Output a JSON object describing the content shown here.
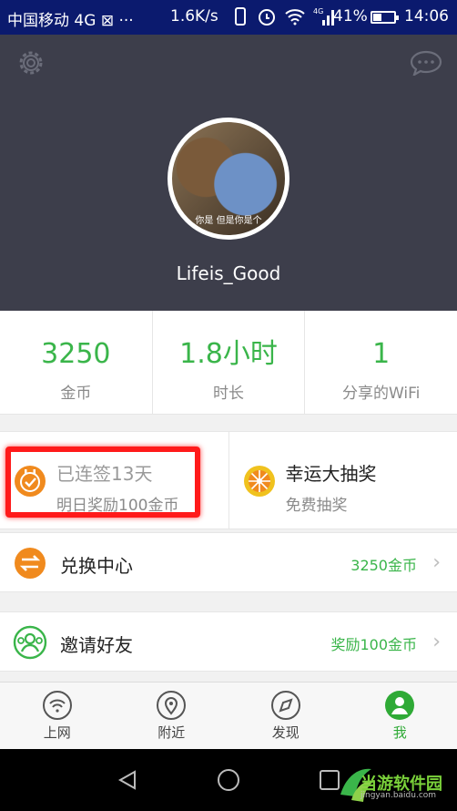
{
  "status_bar": {
    "carrier": "中国移动 4G",
    "extra": "⊠ ···",
    "speed": "1.6K/s",
    "network_type": "4G",
    "battery_percent_text": "41%",
    "battery_level": 0.41,
    "time": "14:06"
  },
  "profile": {
    "avatar_caption": "你是 但是你是个",
    "username": "Lifeis_Good"
  },
  "stats": [
    {
      "value": "3250",
      "label": "金币"
    },
    {
      "value": "1.8小时",
      "label": "时长"
    },
    {
      "value": "1",
      "label": "分享的WiFi"
    }
  ],
  "cards": {
    "signin": {
      "title": "已连签13天",
      "subtitle": "明日奖励100金币"
    },
    "lottery": {
      "title": "幸运大抽奖",
      "subtitle": "免费抽奖"
    }
  },
  "rows": {
    "exchange": {
      "label": "兑换中心",
      "right": "3250金币"
    },
    "invite": {
      "label": "邀请好友",
      "right": "奖励100金币"
    }
  },
  "bottom_nav": [
    {
      "label": "上网",
      "icon": "wifi-icon"
    },
    {
      "label": "附近",
      "icon": "location-pin-icon"
    },
    {
      "label": "发现",
      "icon": "compass-icon"
    },
    {
      "label": "我",
      "icon": "user-icon"
    }
  ],
  "watermark": {
    "text": "当游软件园",
    "url": "jingyan.baidu.com"
  },
  "colors": {
    "accent_green": "#3ab54a",
    "header_bg": "#3d3e4b",
    "status_bar_bg": "#0b1a6e",
    "highlight_red": "#ff1a1a",
    "icon_orange": "#f08a1e"
  }
}
